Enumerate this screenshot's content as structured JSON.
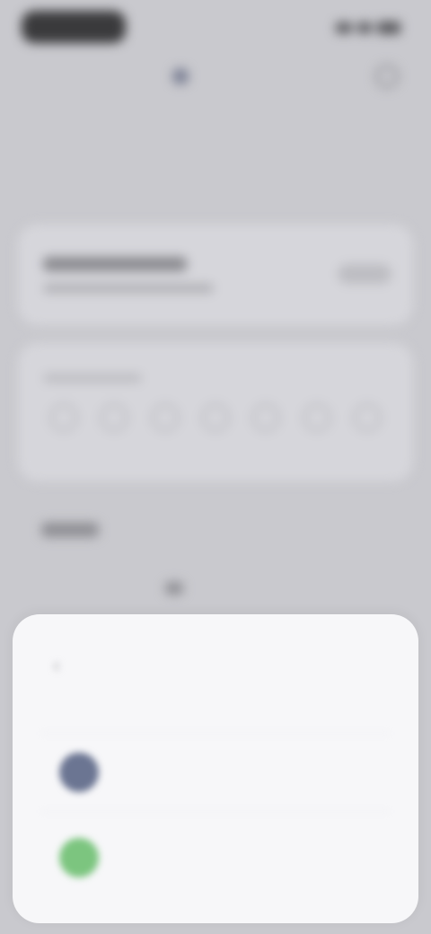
{
  "header": {
    "chip_label": "",
    "title": ""
  },
  "sheet": {
    "title": "",
    "subtitle": "",
    "options": [
      {
        "label": "",
        "icon": "app-icon",
        "color": "#6b7592"
      },
      {
        "label": "",
        "icon": "app-icon",
        "color": "#7cc57f"
      }
    ]
  },
  "colors": {
    "sheet_bg": "#f7f7f9",
    "backdrop": "#c9c9ce"
  }
}
